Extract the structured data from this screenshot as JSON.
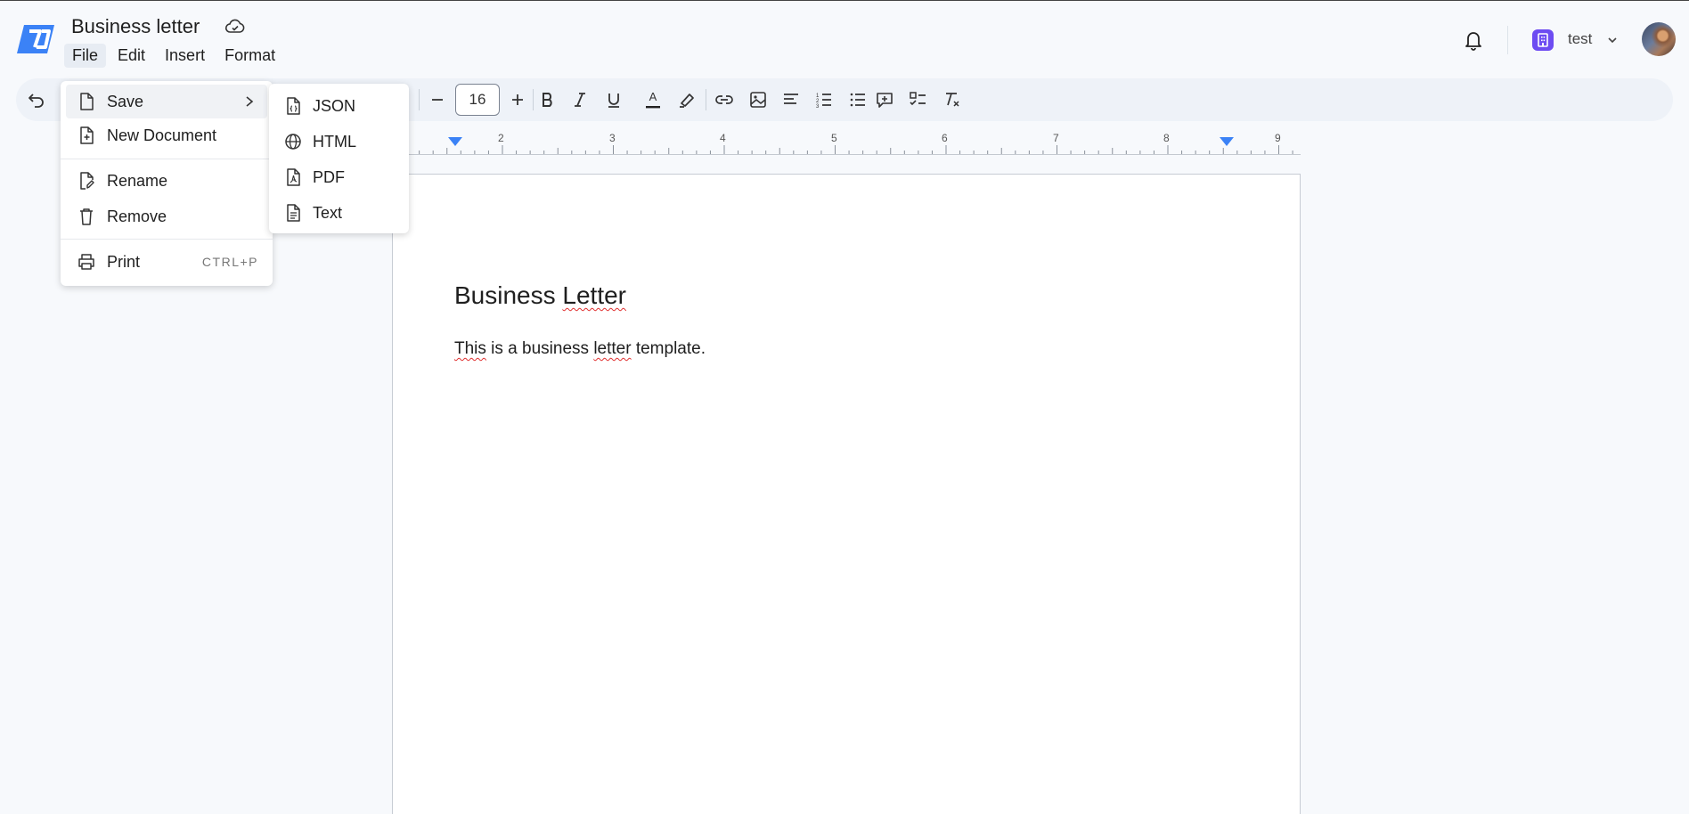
{
  "document": {
    "title": "Business letter"
  },
  "menubar": [
    "File",
    "Edit",
    "Insert",
    "Format"
  ],
  "toolbar": {
    "font_size": "16",
    "text_color_letter": "A"
  },
  "ruler": {
    "numbers": [
      "2",
      "3",
      "4",
      "5",
      "6",
      "7",
      "8",
      "9"
    ]
  },
  "account": {
    "org_name": "test"
  },
  "file_menu": {
    "save": "Save",
    "new_document": "New Document",
    "rename": "Rename",
    "remove": "Remove",
    "print": "Print",
    "print_shortcut": "CTRL+P"
  },
  "save_menu": [
    "JSON",
    "HTML",
    "PDF",
    "Text"
  ],
  "page": {
    "heading": {
      "before": "Business ",
      "misspelled": "Letter"
    },
    "body": {
      "w1": "This",
      "t1": " is a business ",
      "w2": "letter",
      "t2": " template."
    }
  },
  "colors": {
    "accent": "#3b82f6",
    "org_badge": "#6d4cf2"
  }
}
